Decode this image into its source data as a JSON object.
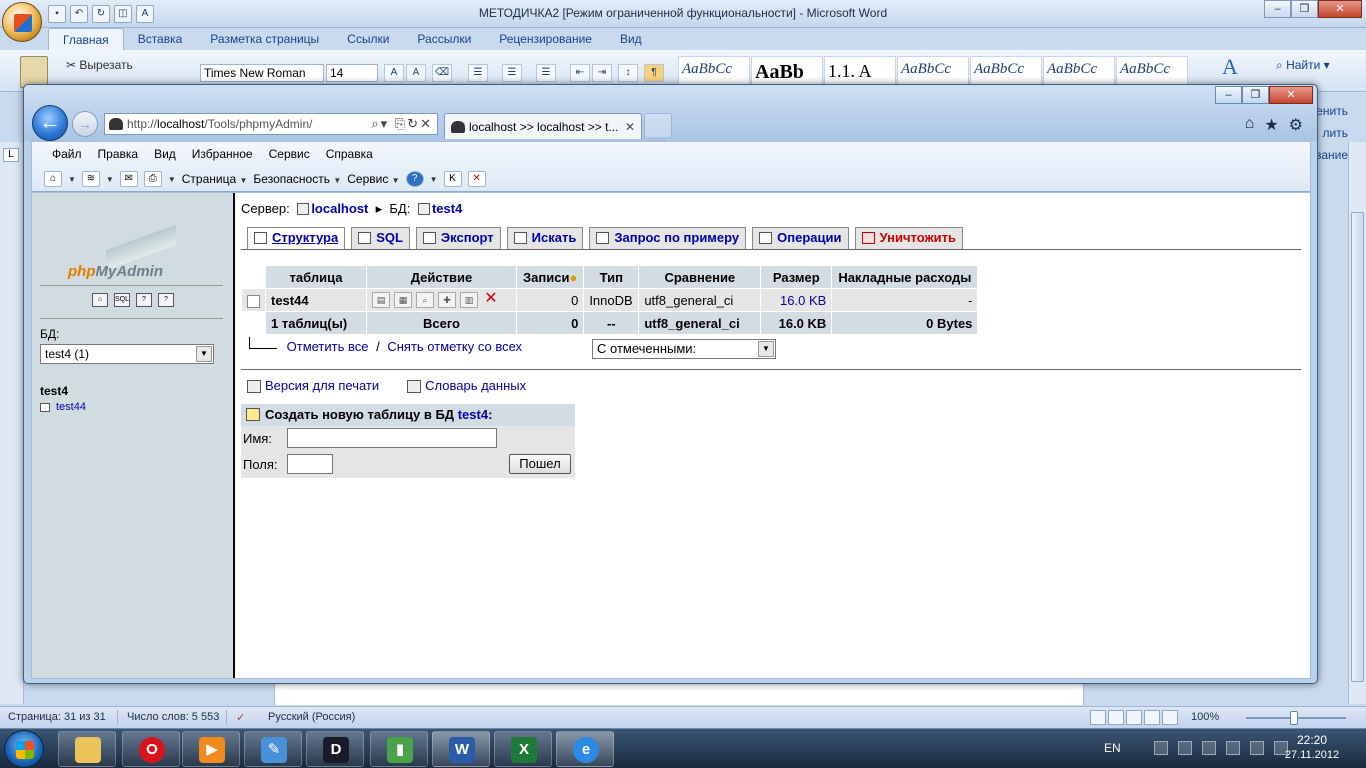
{
  "word": {
    "title": "МЕТОДИЧКА2 [Режим ограниченной функциональности] - Microsoft Word",
    "tabs": [
      "Главная",
      "Вставка",
      "Разметка страницы",
      "Ссылки",
      "Рассылки",
      "Рецензирование",
      "Вид"
    ],
    "active_tab": "Главная",
    "cut_label": "Вырезать",
    "font_name": "Times New Roman",
    "font_size": "14",
    "styles": [
      "AaBbCc",
      "AaBb",
      "1.1. A",
      "AaBbCc",
      "AaBbCc",
      "AaBbCc",
      "AaBbCc"
    ],
    "find_label": "Найти",
    "ribbon_fragments": [
      "Заменить",
      "лить",
      "ование"
    ],
    "status": {
      "page": "Страница: 31 из 31",
      "words": "Число слов: 5 553",
      "language": "Русский (Россия)",
      "zoom": "100%"
    }
  },
  "ie": {
    "url_prefix": "http://",
    "url_host": "localhost",
    "url_path": "/Tools/phpmyAdmin/",
    "tab_title": "localhost >> localhost >> t...",
    "menu": [
      "Файл",
      "Правка",
      "Вид",
      "Избранное",
      "Сервис",
      "Справка"
    ],
    "cmd": {
      "page": "Страница",
      "security": "Безопасность",
      "tools": "Сервис"
    }
  },
  "pma": {
    "logo_php": "php",
    "logo_myadmin": "MyAdmin",
    "db_label": "БД:",
    "db_select": "test4 (1)",
    "nav_db": "test4",
    "nav_table": "test44",
    "crumb": {
      "server_label": "Сервер:",
      "server": "localhost",
      "db_label": "БД:",
      "db": "test4"
    },
    "tabs": [
      {
        "label": "Структура",
        "active": true
      },
      {
        "label": "SQL"
      },
      {
        "label": "Экспорт"
      },
      {
        "label": "Искать"
      },
      {
        "label": "Запрос по примеру"
      },
      {
        "label": "Операции"
      },
      {
        "label": "Уничтожить"
      }
    ],
    "table": {
      "headers": [
        "таблица",
        "Действие",
        "Записи",
        "Тип",
        "Сравнение",
        "Размер",
        "Накладные расходы"
      ],
      "row": {
        "name": "test44",
        "records": "0",
        "type": "InnoDB",
        "collation": "utf8_general_ci",
        "size": "16.0 KB",
        "overhead": "-"
      },
      "summary": {
        "count": "1 таблиц(ы)",
        "total": "Всего",
        "records": "0",
        "type": "--",
        "collation": "utf8_general_ci",
        "size": "16.0 KB",
        "overhead": "0 Bytes"
      }
    },
    "check_all": "Отметить все",
    "separator": "/",
    "uncheck_all": "Снять отметку со всех",
    "with_selected": "С отмеченными:",
    "print_view": "Версия для печати",
    "data_dict": "Словарь данных",
    "create": {
      "title_prefix": "Создать новую таблицу в БД",
      "db": "test4",
      "title_suffix": ":",
      "name_label": "Имя:",
      "fields_label": "Поля:",
      "go": "Пошел"
    }
  },
  "taskbar": {
    "lang": "EN",
    "time": "22:20",
    "date": "27.11.2012"
  }
}
